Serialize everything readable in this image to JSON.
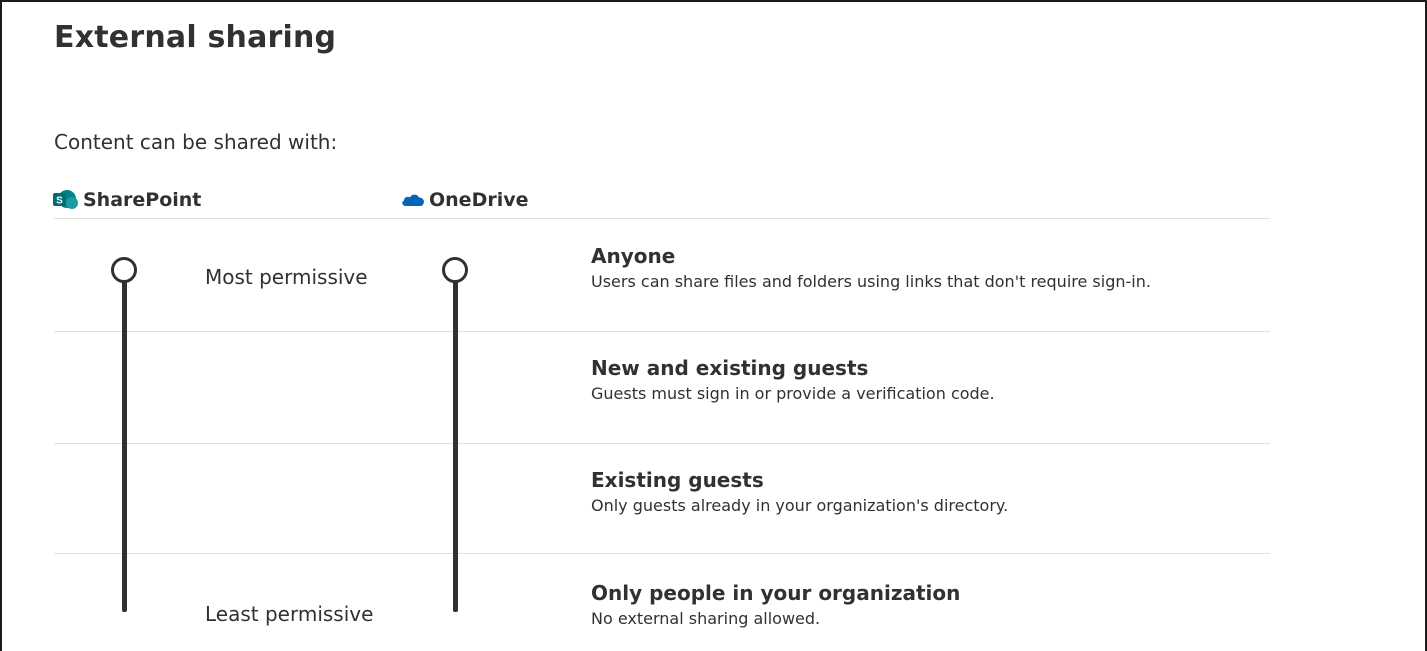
{
  "header": {
    "title": "External sharing"
  },
  "section": {
    "label": "Content can be shared with:"
  },
  "products": {
    "sharepoint": {
      "label": "SharePoint",
      "icon": "sharepoint-icon",
      "color": "#038387"
    },
    "onedrive": {
      "label": "OneDrive",
      "icon": "onedrive-icon",
      "color": "#0364b8"
    }
  },
  "scale": {
    "most_label": "Most permissive",
    "least_label": "Least permissive"
  },
  "sliders": {
    "sharepoint": {
      "selected_option": "Anyone"
    },
    "onedrive": {
      "selected_option": "Anyone"
    }
  },
  "options": [
    {
      "title": "Anyone",
      "description": "Users can share files and folders using links that don't require sign-in."
    },
    {
      "title": "New and existing guests",
      "description": "Guests must sign in or provide a verification code."
    },
    {
      "title": "Existing guests",
      "description": "Only guests already in your organization's directory."
    },
    {
      "title": "Only people in your organization",
      "description": "No external sharing allowed."
    }
  ],
  "colors": {
    "text": "#323130",
    "divider": "#e1dfdd",
    "track": "#323130"
  }
}
